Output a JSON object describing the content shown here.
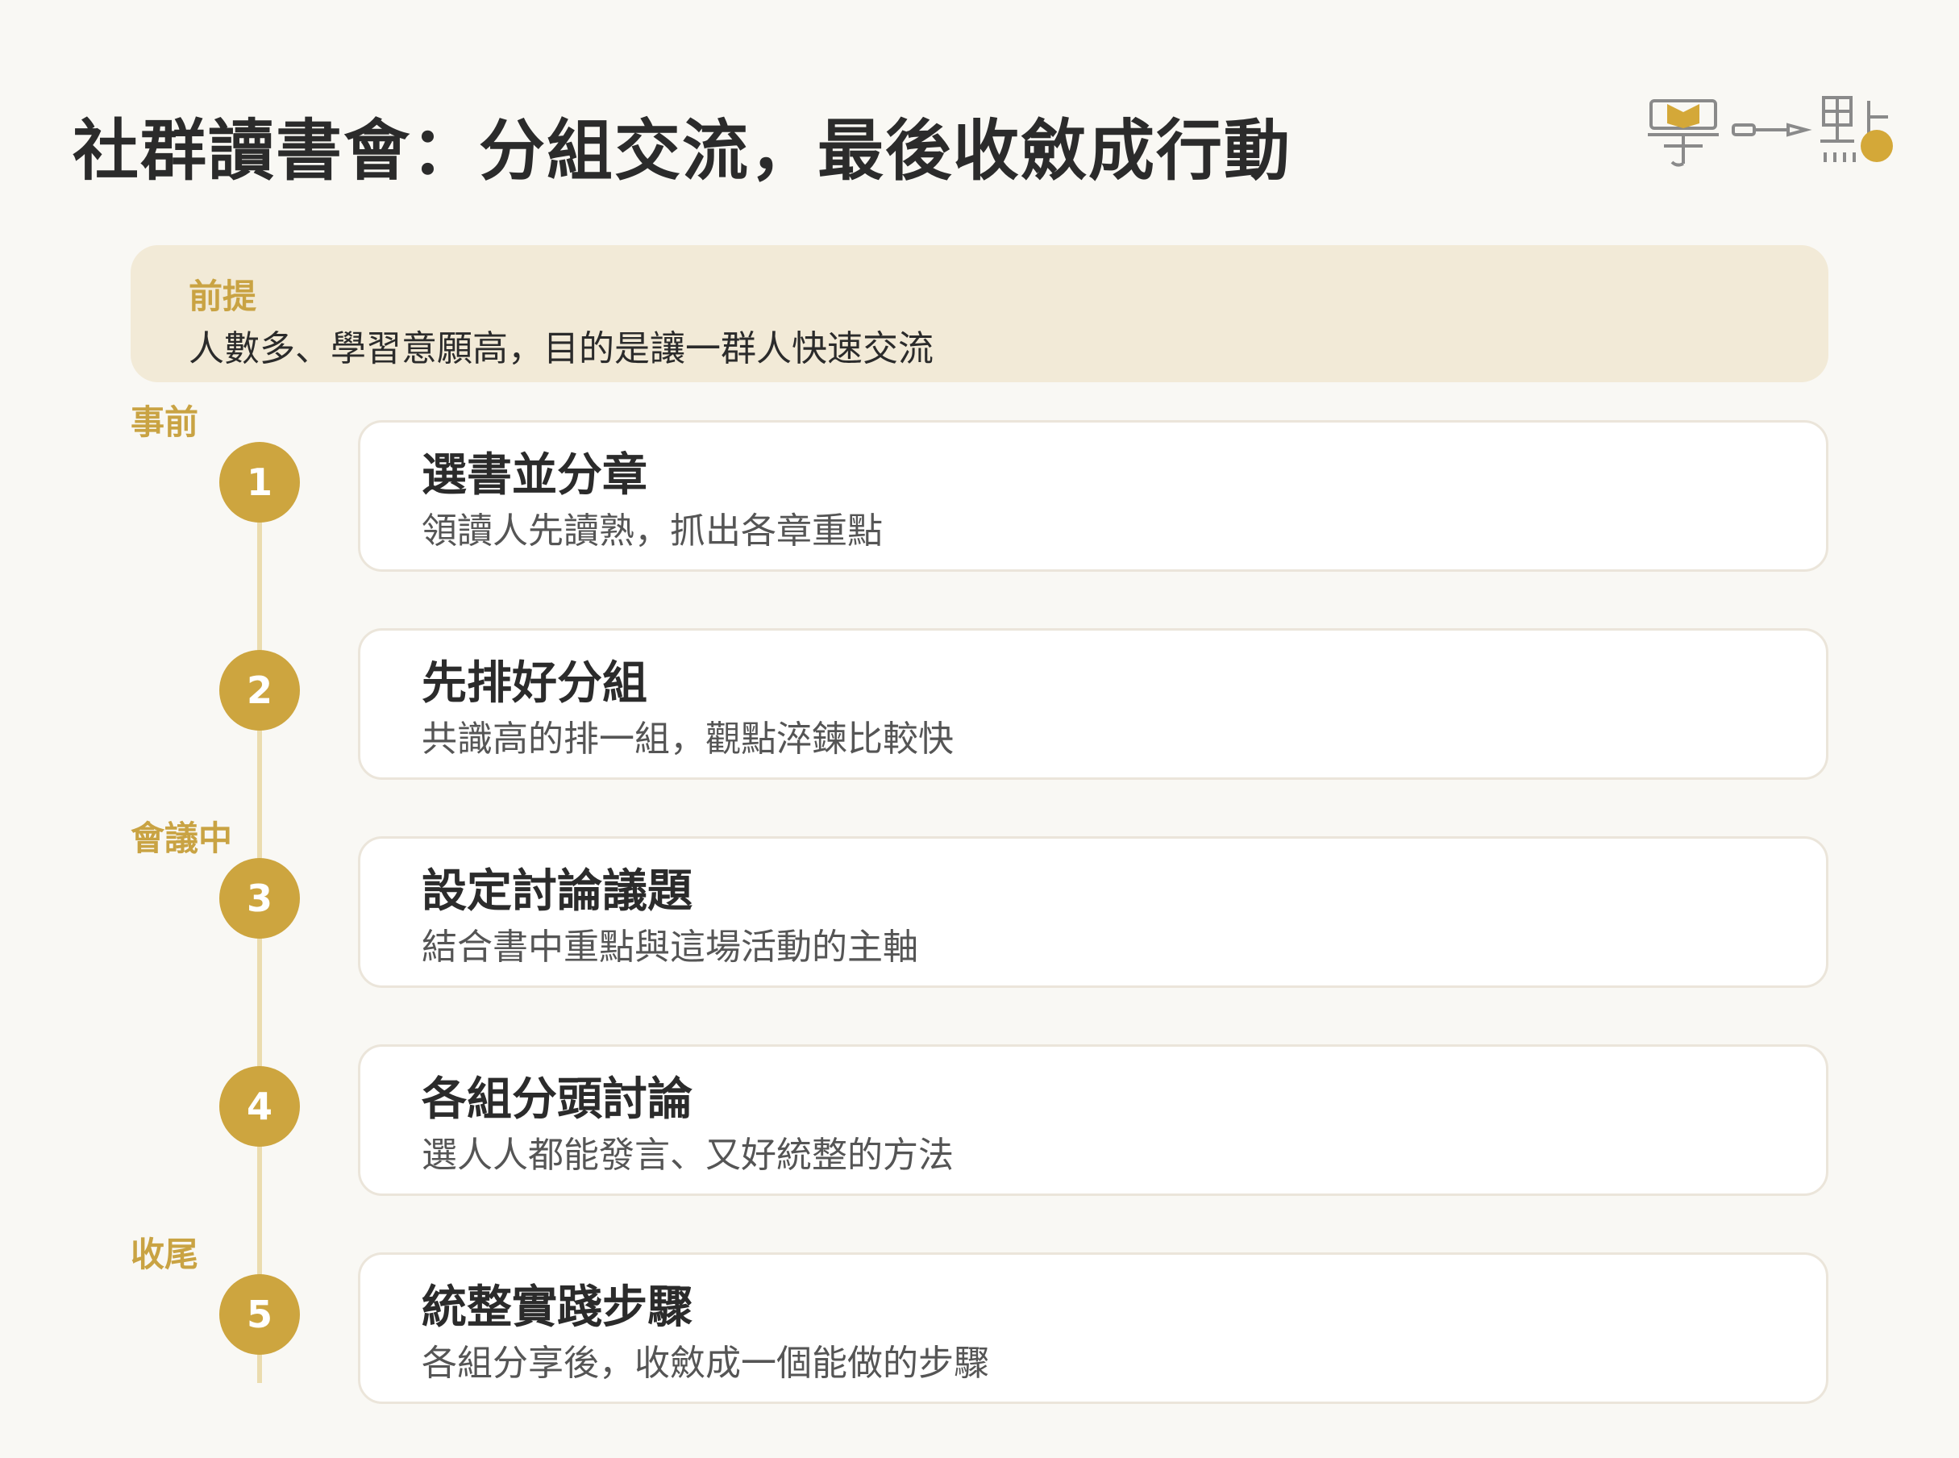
{
  "title": "社群讀書會：分組交流，最後收斂成行動",
  "logo": {
    "chars": [
      "學",
      "一",
      "點"
    ],
    "accent": "#d4a838"
  },
  "premise": {
    "label": "前提",
    "text": "人數多、學習意願高，目的是讓一群人快速交流"
  },
  "phases": [
    "事前",
    "會議中",
    "收尾"
  ],
  "steps": [
    {
      "number": "1",
      "title": "選書並分章",
      "desc": "領讀人先讀熟，抓出各章重點"
    },
    {
      "number": "2",
      "title": "先排好分組",
      "desc": "共識高的排一組，觀點淬鍊比較快"
    },
    {
      "number": "3",
      "title": "設定討論議題",
      "desc": "結合書中重點與這場活動的主軸"
    },
    {
      "number": "4",
      "title": "各組分頭討論",
      "desc": "選人人都能發言、又好統整的方法"
    },
    {
      "number": "5",
      "title": "統整實踐步驟",
      "desc": "各組分享後，收斂成一個能做的步驟"
    }
  ],
  "colors": {
    "background": "#f9f8f4",
    "accent": "#cda53f",
    "premise_bg": "#f2ead7",
    "line": "#ebdcae"
  }
}
